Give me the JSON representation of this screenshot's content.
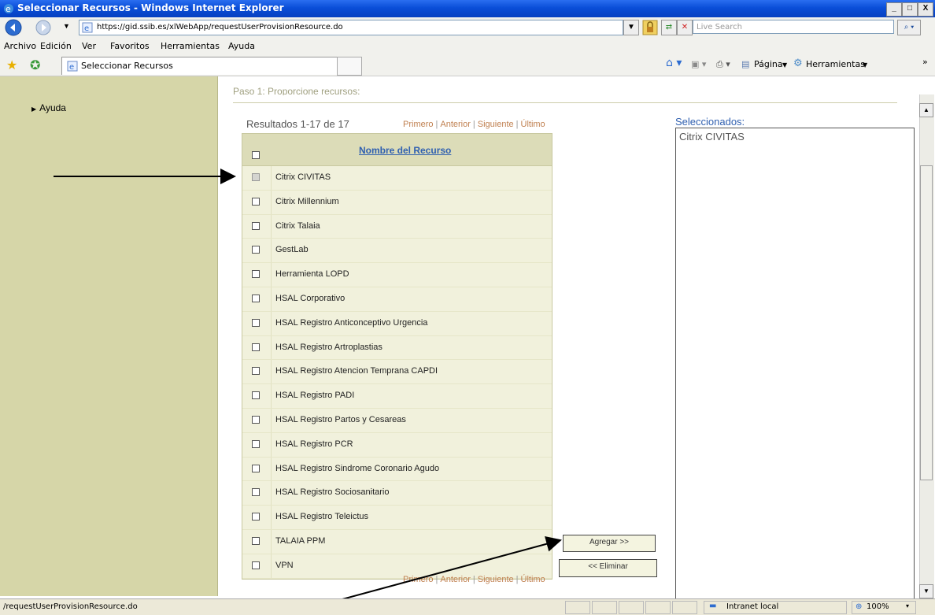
{
  "window": {
    "title": "Seleccionar Recursos - Windows Internet Explorer",
    "minimize": "_",
    "maximize": "□",
    "close": "X"
  },
  "address": {
    "url": "https://gid.ssib.es/xlWebApp/requestUserProvisionResource.do",
    "search_placeholder": "Live Search"
  },
  "menu": [
    "Archivo",
    "Edición",
    "Ver",
    "Favoritos",
    "Herramientas",
    "Ayuda"
  ],
  "tab": {
    "title": "Seleccionar Recursos"
  },
  "toolbar": {
    "page": "Página",
    "tools": "Herramientas",
    "chevron": "»"
  },
  "sidebar": {
    "help": "Ayuda"
  },
  "step": {
    "title": "Paso 1: Proporcione recursos:"
  },
  "results": {
    "label": "Resultados 1-17 de 17",
    "pagination": [
      "Primero",
      "Anterior",
      "Siguiente",
      "Último"
    ]
  },
  "table": {
    "header": "Nombre del Recurso",
    "rows": [
      {
        "name": "Citrix CIVITAS",
        "disabled": true
      },
      {
        "name": "Citrix Millennium",
        "disabled": false
      },
      {
        "name": "Citrix Talaia",
        "disabled": false
      },
      {
        "name": "GestLab",
        "disabled": false
      },
      {
        "name": "Herramienta LOPD",
        "disabled": false
      },
      {
        "name": "HSAL Corporativo",
        "disabled": false
      },
      {
        "name": "HSAL Registro Anticonceptivo Urgencia",
        "disabled": false
      },
      {
        "name": "HSAL Registro Artroplastias",
        "disabled": false
      },
      {
        "name": "HSAL Registro Atencion Temprana CAPDI",
        "disabled": false
      },
      {
        "name": "HSAL Registro PADI",
        "disabled": false
      },
      {
        "name": "HSAL Registro Partos y Cesareas",
        "disabled": false
      },
      {
        "name": "HSAL Registro PCR",
        "disabled": false
      },
      {
        "name": "HSAL Registro Sindrome Coronario Agudo",
        "disabled": false
      },
      {
        "name": "HSAL Registro Sociosanitario",
        "disabled": false
      },
      {
        "name": "HSAL Registro Teleictus",
        "disabled": false
      },
      {
        "name": "TALAIA PPM",
        "disabled": false
      },
      {
        "name": "VPN",
        "disabled": false
      }
    ]
  },
  "buttons": {
    "add": "Agregar >>",
    "remove": "<< Eliminar"
  },
  "selected": {
    "label": "Seleccionados:",
    "items": [
      "Citrix CIVITAS"
    ]
  },
  "status": {
    "text": "/requestUserProvisionResource.do",
    "zone": "Intranet local",
    "zoom": "100%"
  }
}
